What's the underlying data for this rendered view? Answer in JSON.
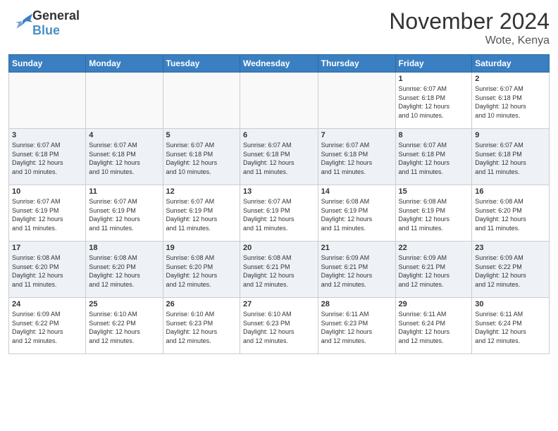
{
  "logo": {
    "general": "General",
    "blue": "Blue"
  },
  "title": "November 2024",
  "location": "Wote, Kenya",
  "days_header": [
    "Sunday",
    "Monday",
    "Tuesday",
    "Wednesday",
    "Thursday",
    "Friday",
    "Saturday"
  ],
  "weeks": [
    {
      "shade": false,
      "days": [
        {
          "num": "",
          "info": ""
        },
        {
          "num": "",
          "info": ""
        },
        {
          "num": "",
          "info": ""
        },
        {
          "num": "",
          "info": ""
        },
        {
          "num": "",
          "info": ""
        },
        {
          "num": "1",
          "info": "Sunrise: 6:07 AM\nSunset: 6:18 PM\nDaylight: 12 hours\nand 10 minutes."
        },
        {
          "num": "2",
          "info": "Sunrise: 6:07 AM\nSunset: 6:18 PM\nDaylight: 12 hours\nand 10 minutes."
        }
      ]
    },
    {
      "shade": true,
      "days": [
        {
          "num": "3",
          "info": "Sunrise: 6:07 AM\nSunset: 6:18 PM\nDaylight: 12 hours\nand 10 minutes."
        },
        {
          "num": "4",
          "info": "Sunrise: 6:07 AM\nSunset: 6:18 PM\nDaylight: 12 hours\nand 10 minutes."
        },
        {
          "num": "5",
          "info": "Sunrise: 6:07 AM\nSunset: 6:18 PM\nDaylight: 12 hours\nand 10 minutes."
        },
        {
          "num": "6",
          "info": "Sunrise: 6:07 AM\nSunset: 6:18 PM\nDaylight: 12 hours\nand 11 minutes."
        },
        {
          "num": "7",
          "info": "Sunrise: 6:07 AM\nSunset: 6:18 PM\nDaylight: 12 hours\nand 11 minutes."
        },
        {
          "num": "8",
          "info": "Sunrise: 6:07 AM\nSunset: 6:18 PM\nDaylight: 12 hours\nand 11 minutes."
        },
        {
          "num": "9",
          "info": "Sunrise: 6:07 AM\nSunset: 6:18 PM\nDaylight: 12 hours\nand 11 minutes."
        }
      ]
    },
    {
      "shade": false,
      "days": [
        {
          "num": "10",
          "info": "Sunrise: 6:07 AM\nSunset: 6:19 PM\nDaylight: 12 hours\nand 11 minutes."
        },
        {
          "num": "11",
          "info": "Sunrise: 6:07 AM\nSunset: 6:19 PM\nDaylight: 12 hours\nand 11 minutes."
        },
        {
          "num": "12",
          "info": "Sunrise: 6:07 AM\nSunset: 6:19 PM\nDaylight: 12 hours\nand 11 minutes."
        },
        {
          "num": "13",
          "info": "Sunrise: 6:07 AM\nSunset: 6:19 PM\nDaylight: 12 hours\nand 11 minutes."
        },
        {
          "num": "14",
          "info": "Sunrise: 6:08 AM\nSunset: 6:19 PM\nDaylight: 12 hours\nand 11 minutes."
        },
        {
          "num": "15",
          "info": "Sunrise: 6:08 AM\nSunset: 6:19 PM\nDaylight: 12 hours\nand 11 minutes."
        },
        {
          "num": "16",
          "info": "Sunrise: 6:08 AM\nSunset: 6:20 PM\nDaylight: 12 hours\nand 11 minutes."
        }
      ]
    },
    {
      "shade": true,
      "days": [
        {
          "num": "17",
          "info": "Sunrise: 6:08 AM\nSunset: 6:20 PM\nDaylight: 12 hours\nand 11 minutes."
        },
        {
          "num": "18",
          "info": "Sunrise: 6:08 AM\nSunset: 6:20 PM\nDaylight: 12 hours\nand 12 minutes."
        },
        {
          "num": "19",
          "info": "Sunrise: 6:08 AM\nSunset: 6:20 PM\nDaylight: 12 hours\nand 12 minutes."
        },
        {
          "num": "20",
          "info": "Sunrise: 6:08 AM\nSunset: 6:21 PM\nDaylight: 12 hours\nand 12 minutes."
        },
        {
          "num": "21",
          "info": "Sunrise: 6:09 AM\nSunset: 6:21 PM\nDaylight: 12 hours\nand 12 minutes."
        },
        {
          "num": "22",
          "info": "Sunrise: 6:09 AM\nSunset: 6:21 PM\nDaylight: 12 hours\nand 12 minutes."
        },
        {
          "num": "23",
          "info": "Sunrise: 6:09 AM\nSunset: 6:22 PM\nDaylight: 12 hours\nand 12 minutes."
        }
      ]
    },
    {
      "shade": false,
      "days": [
        {
          "num": "24",
          "info": "Sunrise: 6:09 AM\nSunset: 6:22 PM\nDaylight: 12 hours\nand 12 minutes."
        },
        {
          "num": "25",
          "info": "Sunrise: 6:10 AM\nSunset: 6:22 PM\nDaylight: 12 hours\nand 12 minutes."
        },
        {
          "num": "26",
          "info": "Sunrise: 6:10 AM\nSunset: 6:23 PM\nDaylight: 12 hours\nand 12 minutes."
        },
        {
          "num": "27",
          "info": "Sunrise: 6:10 AM\nSunset: 6:23 PM\nDaylight: 12 hours\nand 12 minutes."
        },
        {
          "num": "28",
          "info": "Sunrise: 6:11 AM\nSunset: 6:23 PM\nDaylight: 12 hours\nand 12 minutes."
        },
        {
          "num": "29",
          "info": "Sunrise: 6:11 AM\nSunset: 6:24 PM\nDaylight: 12 hours\nand 12 minutes."
        },
        {
          "num": "30",
          "info": "Sunrise: 6:11 AM\nSunset: 6:24 PM\nDaylight: 12 hours\nand 12 minutes."
        }
      ]
    }
  ]
}
